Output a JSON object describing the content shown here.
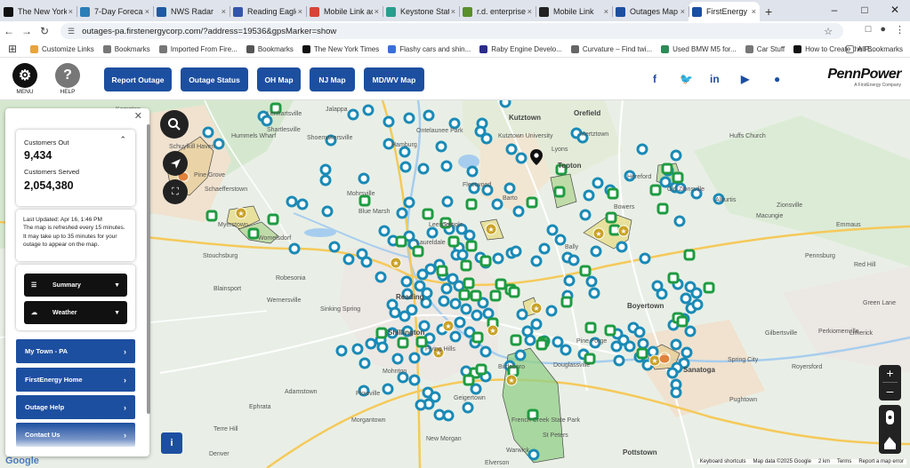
{
  "browser": {
    "tabs": [
      {
        "label": "The New York Ti",
        "icon": "nyt-icon",
        "color": "#111111",
        "active": false
      },
      {
        "label": "7-Day Forecast",
        "icon": "weather-icon",
        "color": "#2a7fb8",
        "active": false
      },
      {
        "label": "NWS Radar",
        "icon": "nws-icon",
        "color": "#1f5aa6",
        "active": false
      },
      {
        "label": "Reading Eagle",
        "icon": "news-icon",
        "color": "#3355aa",
        "active": false
      },
      {
        "label": "Mobile Link acc",
        "icon": "gmail-icon",
        "color": "#d44638",
        "active": false
      },
      {
        "label": "Keystone State",
        "icon": "keystone-icon",
        "color": "#2a9d8f",
        "active": false
      },
      {
        "label": "r.d. enterprises",
        "icon": "rd-icon",
        "color": "#5a8f2a",
        "active": false
      },
      {
        "label": "Mobile Link",
        "icon": "mobile-link-icon",
        "color": "#222222",
        "active": false
      },
      {
        "label": "Outages Map",
        "icon": "outages-icon",
        "color": "#1d4fa0",
        "active": false
      },
      {
        "label": "FirstEnergy Sto",
        "icon": "firstenergy-icon",
        "color": "#1d4fa0",
        "active": true
      }
    ],
    "url": "outages-pa.firstenergycorp.com/?address=19536&gpsMarker=show",
    "bookmarks": [
      {
        "label": "Customize Links",
        "color": "#e8a33d"
      },
      {
        "label": "Bookmarks",
        "color": "#777777"
      },
      {
        "label": "Imported From Fire...",
        "color": "#777777"
      },
      {
        "label": "Bookmarks",
        "color": "#555555"
      },
      {
        "label": "The New York Times",
        "color": "#111111"
      },
      {
        "label": "Flashy cars and shin...",
        "color": "#3a6fd8"
      },
      {
        "label": "Raby Engine Develo...",
        "color": "#2b2b8a"
      },
      {
        "label": "Curvature – Find twi...",
        "color": "#666666"
      },
      {
        "label": "Used BMW M5 for...",
        "color": "#2e8b57"
      },
      {
        "label": "Car Stuff",
        "color": "#777777"
      },
      {
        "label": "How to Create the P...",
        "color": "#111111"
      }
    ],
    "all_bookmarks": "All Bookmarks"
  },
  "header": {
    "menu_label": "MENU",
    "help_label": "HELP",
    "nav": [
      "Report Outage",
      "Outage Status",
      "OH Map",
      "NJ Map",
      "MD/WV Map"
    ],
    "logo_text": "PennPower",
    "logo_sub": "A FirstEnergy Company",
    "social": [
      "facebook-icon",
      "twitter-icon",
      "linkedin-icon",
      "youtube-icon",
      "flickr-icon"
    ]
  },
  "panel": {
    "customers_out_label": "Customers Out",
    "customers_out": "9,434",
    "customers_served_label": "Customers Served",
    "customers_served": "2,054,380",
    "last_updated": "Last Updated: Apr 16, 1:46 PM",
    "refresh_note": "The map is refreshed every 15 minutes. It may take up to 35 minutes for your outage to appear on the map.",
    "dropdowns": [
      "Summary",
      "Weather"
    ],
    "links": [
      "My Town - PA",
      "FirstEnergy Home",
      "Outage Help",
      "Contact Us"
    ]
  },
  "map": {
    "labels": [
      "Jalappa",
      "Orwigsburg",
      "Kutztown",
      "Orefield",
      "Schuylkill Haven",
      "Shoemakersville",
      "Mertztown",
      "Pine Grove",
      "Hamburg",
      "Lenhartsville",
      "Mohrsville",
      "Fleetwood",
      "Topton",
      "Schaefferstown",
      "Myerstown",
      "Leesport",
      "Bally",
      "Pottstown",
      "Reading",
      "Boyertown",
      "Wernersville",
      "Mohnton",
      "Birdsboro",
      "Douglassville",
      "Shillington",
      "Pine Forge",
      "Sanatoga",
      "Flying Hills",
      "Morgantown",
      "Elverson",
      "Warwick",
      "St Peters",
      "French Creek State Park",
      "Denver",
      "Shartlesville",
      "Stouchsburg",
      "Womelsdorf",
      "Temple",
      "Laureldale",
      "Huffs Church",
      "Barto",
      "Hereford",
      "Macungie",
      "Emmaus",
      "Alburtis",
      "Zionsville",
      "Red Hill",
      "Pennsburg",
      "Green Lane",
      "Perkiomenville",
      "Gilbertsville",
      "Limerick",
      "Royersford",
      "Spring City",
      "Pughtown",
      "Ephrata",
      "Adamstown",
      "Terre Hill",
      "Blainsport",
      "New Morgan",
      "Blue Marsh",
      "Sinking Spring",
      "Robesonia",
      "Hummels Wharf",
      "Plowville",
      "Geigertown",
      "Kempton",
      "Wanamakers",
      "Old Zionsville",
      "Bowers",
      "Lyons",
      "Kutztown University",
      "Ontelaunee Park"
    ],
    "attribution_left": "Google",
    "attribution_right": [
      "Keyboard shortcuts",
      "Map data ©2025 Google",
      "2 km",
      "Terms",
      "Report a map error"
    ]
  }
}
